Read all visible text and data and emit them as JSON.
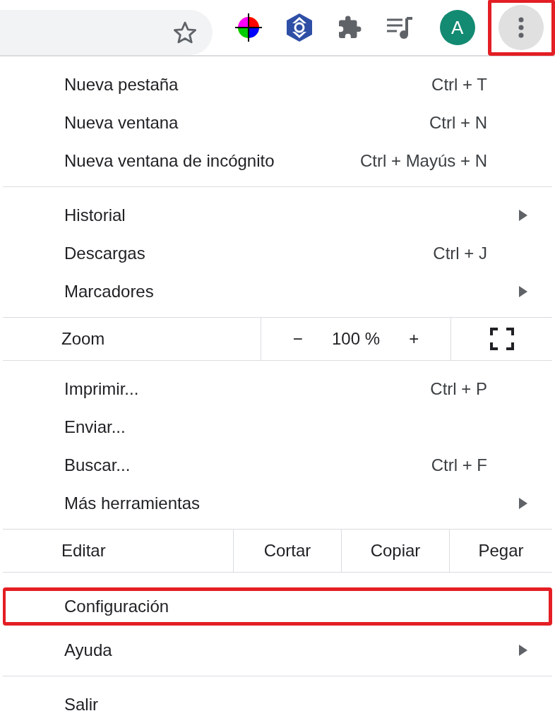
{
  "toolbar": {
    "avatar_letter": "A",
    "menu_button": {
      "highlighted": true
    }
  },
  "menu": {
    "sections": [
      {
        "items": [
          {
            "kind": "item",
            "label": "Nueva pestaña",
            "shortcut": "Ctrl + T",
            "submenu": false,
            "highlighted": false
          },
          {
            "kind": "item",
            "label": "Nueva ventana",
            "shortcut": "Ctrl + N",
            "submenu": false,
            "highlighted": false
          },
          {
            "kind": "item",
            "label": "Nueva ventana de incógnito",
            "shortcut": "Ctrl + Mayús + N",
            "submenu": false,
            "highlighted": false
          }
        ]
      },
      {
        "items": [
          {
            "kind": "item",
            "label": "Historial",
            "submenu": true,
            "highlighted": false
          },
          {
            "kind": "item",
            "label": "Descargas",
            "shortcut": "Ctrl + J",
            "submenu": false,
            "highlighted": false
          },
          {
            "kind": "item",
            "label": "Marcadores",
            "submenu": true,
            "highlighted": false
          }
        ]
      },
      {
        "items": [
          {
            "kind": "zoom",
            "label": "Zoom",
            "minus": "−",
            "value": "100 %",
            "plus": "+"
          }
        ]
      },
      {
        "items": [
          {
            "kind": "item",
            "label": "Imprimir...",
            "shortcut": "Ctrl + P",
            "submenu": false,
            "highlighted": false
          },
          {
            "kind": "item",
            "label": "Enviar...",
            "submenu": false,
            "highlighted": false
          },
          {
            "kind": "item",
            "label": "Buscar...",
            "shortcut": "Ctrl + F",
            "submenu": false,
            "highlighted": false
          },
          {
            "kind": "item",
            "label": "Más herramientas",
            "submenu": true,
            "highlighted": false
          }
        ]
      },
      {
        "items": [
          {
            "kind": "edit",
            "label": "Editar",
            "actions": [
              "Cortar",
              "Copiar",
              "Pegar"
            ]
          }
        ]
      },
      {
        "items": [
          {
            "kind": "item",
            "label": "Configuración",
            "submenu": false,
            "highlighted": true
          },
          {
            "kind": "item",
            "label": "Ayuda",
            "submenu": true,
            "highlighted": false
          }
        ]
      },
      {
        "items": [
          {
            "kind": "item",
            "label": "Salir",
            "submenu": false,
            "highlighted": false
          }
        ]
      }
    ]
  }
}
